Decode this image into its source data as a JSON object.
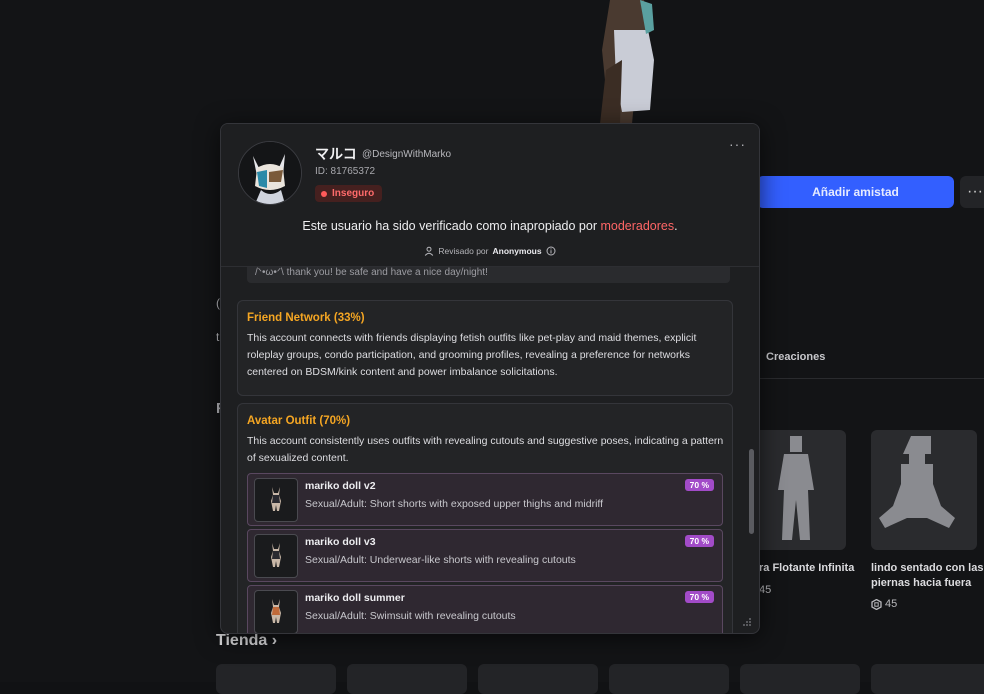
{
  "background": {
    "add_friend_label": "Añadir amistad",
    "more_label": "···",
    "creaciones_tab": "Creaciones",
    "left_fragments": [
      "(",
      "t",
      "t",
      "F",
      "(",
      "("
    ],
    "cards": [
      {
        "title": "ra Flotante Infinita",
        "price": "45"
      },
      {
        "title": "lindo sentado con las piernas hacia fuera",
        "price": "45"
      }
    ],
    "shop_heading": "Tienda"
  },
  "modal": {
    "menu_label": "···",
    "user": {
      "display_name": "マルコ",
      "handle": "@DesignWithMarko",
      "id_text": "ID: 81765372",
      "status_badge": "Inseguro"
    },
    "verified_text": "Este usuario ha sido verificado como inapropiado por ",
    "verified_link": "moderadores",
    "verified_end": ".",
    "reviewed_prefix": "Revisado por",
    "reviewed_by": "Anonymous",
    "quote_fragment": "/ᐠ•ω•ᐟ\\ thank you! be safe and have a nice day/night!",
    "sections": [
      {
        "title": "Friend Network (33%)",
        "text": "This account connects with friends displaying fetish outfits like pet-play and maid themes, explicit roleplay groups, condo participation, and grooming profiles, revealing a preference for networks centered on BDSM/kink content and power imbalance solicitations."
      },
      {
        "title": "Avatar Outfit (70%)",
        "text": "This account consistently uses outfits with revealing cutouts and suggestive poses, indicating a pattern of sexualized content.",
        "items": [
          {
            "name": "mariko doll v2",
            "desc": "Sexual/Adult: Short shorts with exposed upper thighs and midriff",
            "pct": "70 %"
          },
          {
            "name": "mariko doll v3",
            "desc": "Sexual/Adult: Underwear-like shorts with revealing cutouts",
            "pct": "70 %"
          },
          {
            "name": "mariko doll summer",
            "desc": "Sexual/Adult: Swimsuit with revealing cutouts",
            "pct": "70 %"
          }
        ]
      }
    ]
  },
  "colors": {
    "accent_blue": "#335fff",
    "warning_orange": "#f5a623",
    "danger_red": "#ff5a5a",
    "percent_purple": "#a24bc8"
  }
}
